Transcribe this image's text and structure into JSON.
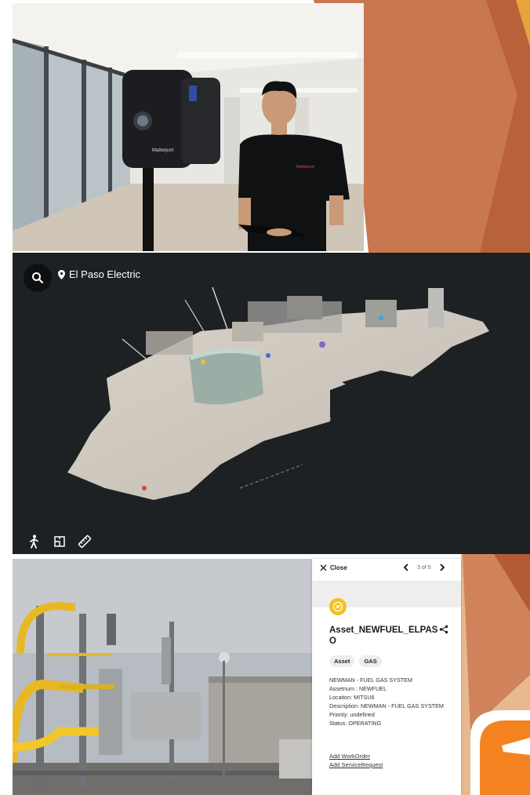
{
  "photo1": {
    "camera_brand": "Matterport",
    "shirt_brand": "Matterport"
  },
  "viewer": {
    "location_label": "El Paso Electric",
    "icons": [
      "search-icon",
      "location-pin-icon",
      "walk-icon",
      "floorplan-icon",
      "measure-icon"
    ]
  },
  "asset_panel": {
    "close_label": "Close",
    "pager_label": "3 of 5",
    "title": "Asset_NEWFUEL_ELPASO",
    "tags": [
      "Asset",
      "GAS"
    ],
    "details": [
      "NEWMAN - FUEL GAS SYSTEM",
      "Assetnum : NEWFUEL",
      "Location: MITSU6",
      "Description: NEWMAN - FUEL GAS SYSTEM",
      "Priority: undefined",
      "Status: OPERATING"
    ],
    "links": [
      "Add WorkOrder",
      "Add ServiceRequest"
    ],
    "accent_color": "#f3c21c"
  },
  "theme": {
    "slide_orange": "#c8714a",
    "slide_bright_orange": "#f7941d",
    "viewer_bg": "#1e2124"
  }
}
